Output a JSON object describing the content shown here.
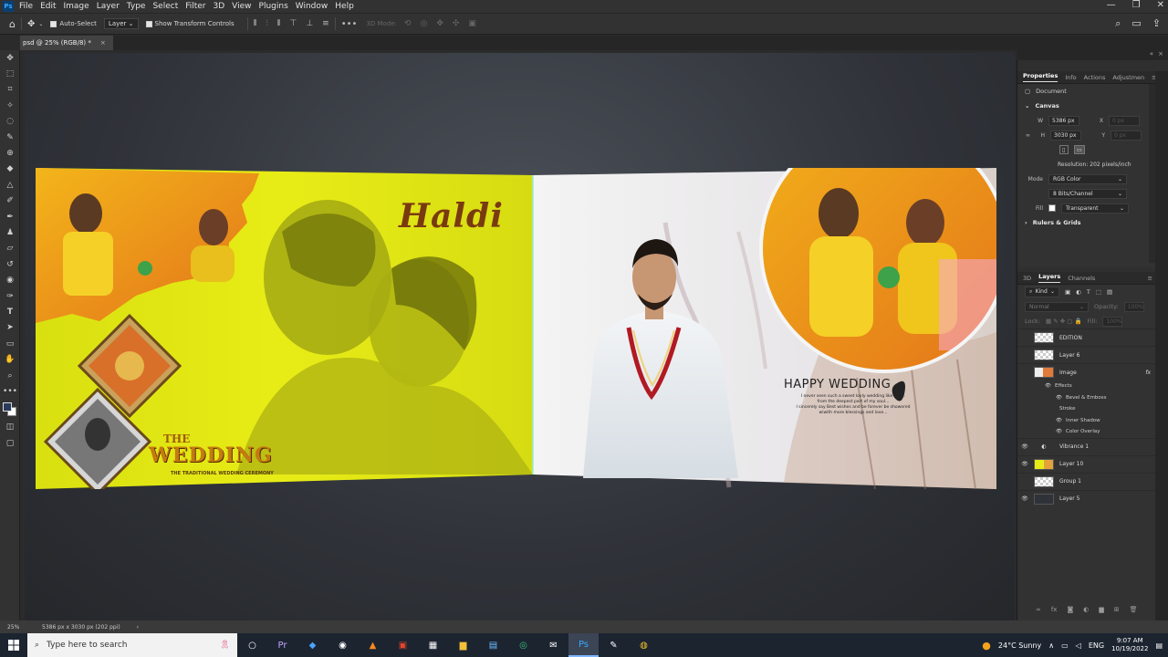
{
  "menubar": {
    "app_logo": "Ps",
    "items": [
      "File",
      "Edit",
      "Image",
      "Layer",
      "Type",
      "Select",
      "Filter",
      "3D",
      "View",
      "Plugins",
      "Window",
      "Help"
    ]
  },
  "options": {
    "auto_select": "Auto-Select",
    "layer_select": "Layer",
    "show_transform": "Show Transform Controls",
    "mode_3d": "3D Mode:"
  },
  "document": {
    "tab_title": "psd @ 25% (RGB/8) *",
    "zoom": "25%",
    "doc_info": "5386 px x 3030 px (202 ppi)"
  },
  "artwork": {
    "haldi": "Haldi",
    "the": "THE",
    "wedding": "WEDDING",
    "wedding_sub": "THE TRADITIONAL WEDDING CEREMONY",
    "happy_title": "HAPPY WEDDING",
    "happy_body": [
      "I never seen such a sweet lovly wedding like you...",
      "from the deepest part of my soul...",
      "I sincerely say Best wishes and be forever be showered",
      "wiwith more blessings and love..."
    ]
  },
  "properties": {
    "tabs": [
      "Properties",
      "Info",
      "Actions",
      "Adjustmen"
    ],
    "document_label": "Document",
    "canvas_label": "Canvas",
    "w_label": "W",
    "w_value": "5386 px",
    "h_label": "H",
    "h_value": "3030 px",
    "x_label": "X",
    "x_value": "0 px",
    "y_label": "Y",
    "y_value": "0 px",
    "resolution": "Resolution: 202 pixels/inch",
    "mode_label": "Mode",
    "mode_value": "RGB Color",
    "bits_value": "8 Bits/Channel",
    "fill_label": "Fill",
    "fill_value": "Transparent",
    "rulers_label": "Rulers & Grids"
  },
  "layers_panel": {
    "tabs": [
      "3D",
      "Layers",
      "Channels"
    ],
    "kind": "Kind",
    "blend_mode": "Normal",
    "opacity_label": "Opacity:",
    "opacity_value": "100%",
    "lock_label": "Lock:",
    "fill_label": "Fill:",
    "fill_value": "100%",
    "layers": [
      {
        "name": "EDITION",
        "visible": false
      },
      {
        "name": "Layer 6",
        "visible": false
      },
      {
        "name": "Image",
        "visible": false,
        "fx": "fx"
      },
      {
        "name": "Vibrance 1",
        "visible": true
      },
      {
        "name": "Layer 10",
        "visible": true
      },
      {
        "name": "Group 1",
        "visible": false
      },
      {
        "name": "Layer 5",
        "visible": true
      }
    ],
    "effects_label": "Effects",
    "effects": [
      "Bevel & Emboss",
      "Stroke",
      "Inner Shadow",
      "Color Overlay"
    ]
  },
  "taskbar": {
    "search_placeholder": "Type here to search",
    "weather": "24°C  Sunny",
    "language": "ENG",
    "time": "9:07 AM",
    "date": "10/19/2022"
  },
  "colors": {
    "ui_dark": "#323232",
    "canvas_bg": "#2f3238",
    "haldi_yellow": "#e8ec16",
    "taskbar": "#1c2430"
  }
}
